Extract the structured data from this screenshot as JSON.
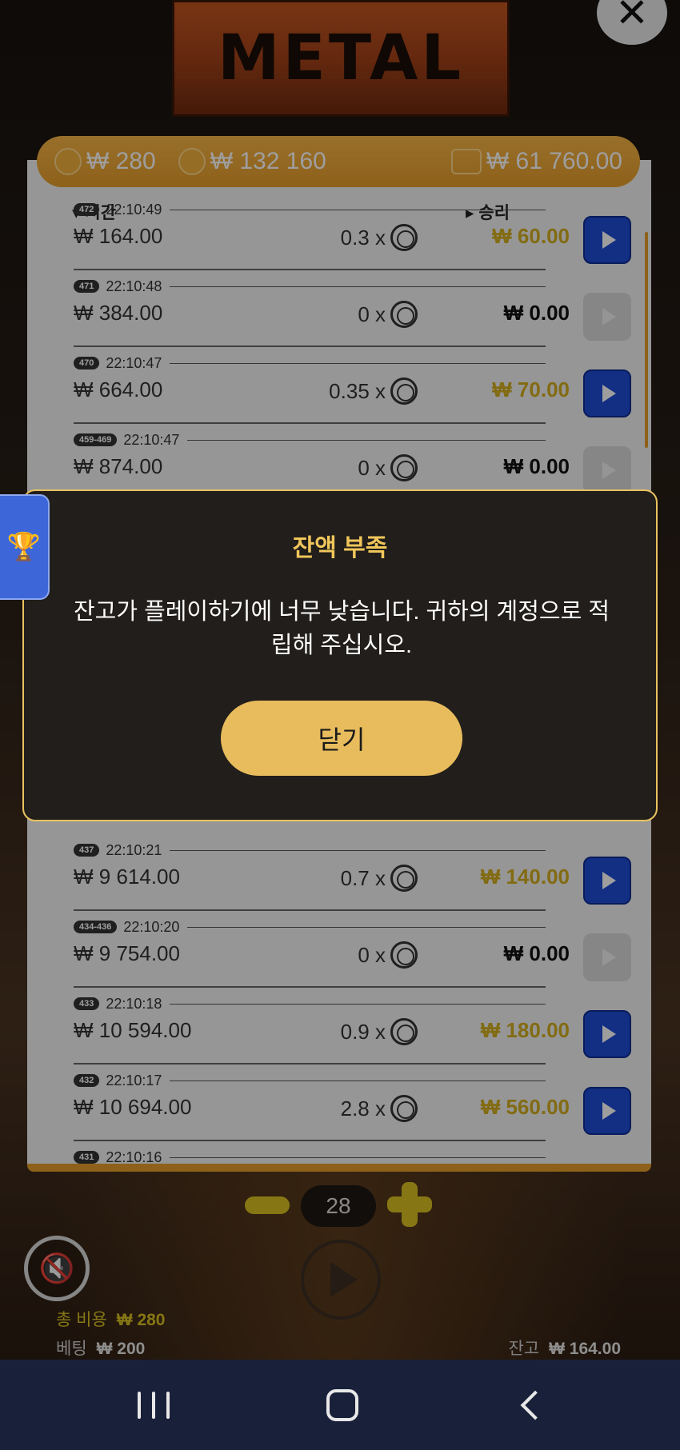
{
  "game": {
    "logo_text": "METAL"
  },
  "balance_bar": {
    "bet_amount": "₩ 280",
    "jackpot": "₩ 132 160",
    "wallet": "₩ 61 760.00"
  },
  "history": {
    "col_time": "▾ 시간",
    "col_win": "▸ 승리",
    "rows": [
      {
        "badge": "472",
        "time": "22:10:49",
        "bet": "₩ 164.00",
        "mult": "0.3 x",
        "win": "₩ 60.00",
        "gold": true,
        "active": true
      },
      {
        "badge": "471",
        "time": "22:10:48",
        "bet": "₩ 384.00",
        "mult": "0 x",
        "win": "₩ 0.00",
        "gold": false,
        "active": false
      },
      {
        "badge": "470",
        "time": "22:10:47",
        "bet": "₩ 664.00",
        "mult": "0.35 x",
        "win": "₩ 70.00",
        "gold": true,
        "active": true
      },
      {
        "badge": "459-469",
        "time": "22:10:47",
        "bet": "₩ 874.00",
        "mult": "0 x",
        "win": "₩ 0.00",
        "gold": false,
        "active": false
      },
      {
        "badge": "437",
        "time": "22:10:21",
        "bet": "₩ 9 614.00",
        "mult": "0.7 x",
        "win": "₩ 140.00",
        "gold": true,
        "active": true
      },
      {
        "badge": "434-436",
        "time": "22:10:20",
        "bet": "₩ 9 754.00",
        "mult": "0 x",
        "win": "₩ 0.00",
        "gold": false,
        "active": false
      },
      {
        "badge": "433",
        "time": "22:10:18",
        "bet": "₩ 10 594.00",
        "mult": "0.9 x",
        "win": "₩ 180.00",
        "gold": true,
        "active": true
      },
      {
        "badge": "432",
        "time": "22:10:17",
        "bet": "₩ 10 694.00",
        "mult": "2.8 x",
        "win": "₩ 560.00",
        "gold": true,
        "active": true
      },
      {
        "badge": "431",
        "time": "22:10:16",
        "bet": "",
        "mult": "",
        "win": "",
        "gold": false,
        "active": true
      }
    ]
  },
  "modal": {
    "title": "잔액 부족",
    "message": "잔고가 플레이하기에 너무 낮습니다. 귀하의 계정으로 적립해 주십시오.",
    "button": "닫기"
  },
  "controls": {
    "stepper_value": "28",
    "total_cost_label": "총 비용",
    "total_cost_value": "₩ 280",
    "bet_label": "베팅",
    "bet_value": "₩ 200",
    "balance_label": "잔고",
    "balance_value": "₩ 164.00"
  },
  "icons": {
    "close": "close-icon",
    "trophy": "trophy-icon",
    "mute": "speaker-muted-icon",
    "spin": "play-icon"
  },
  "colors": {
    "accent_orange": "#e59d2a",
    "gold_text": "#d2ad1e",
    "modal_border": "#e8c25e",
    "play_blue": "#1f4dd6"
  }
}
